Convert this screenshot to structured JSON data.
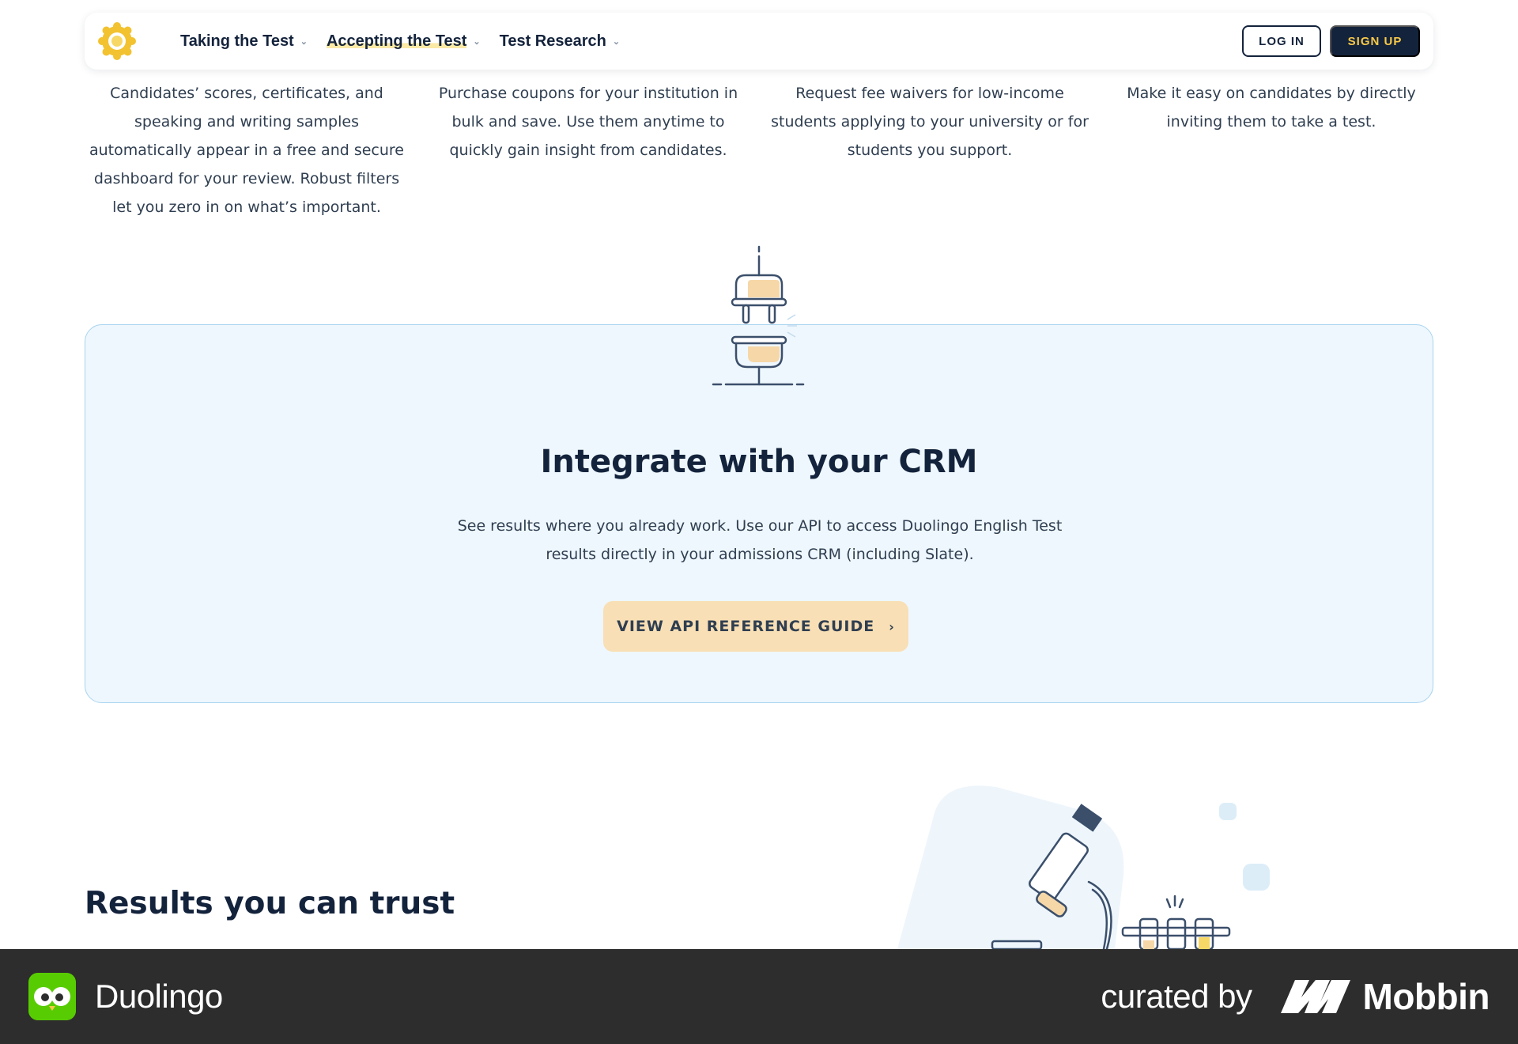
{
  "nav": {
    "items": [
      {
        "label": "Taking the Test"
      },
      {
        "label": "Accepting the Test"
      },
      {
        "label": "Test Research"
      }
    ],
    "login_label": "LOG IN",
    "signup_label": "SIGN UP"
  },
  "features": [
    {
      "text": "Candidates’ scores, certificates, and speaking and writing samples automatically appear in a free and secure dashboard for your review. Robust filters let you zero in on what’s important."
    },
    {
      "text": "Purchase coupons for your institution in bulk and save. Use them anytime to quickly gain insight from candidates."
    },
    {
      "text": "Request fee waivers for low-income students applying to your university or for students you support."
    },
    {
      "text": "Make it easy on candidates by directly inviting them to take a test."
    }
  ],
  "crm": {
    "title": "Integrate with your CRM",
    "body": "See results where you already work. Use our API to access Duolingo English Test results directly in your admissions CRM (including Slate).",
    "button_label": "VIEW API REFERENCE GUIDE",
    "button_icon": "chevron-right-icon"
  },
  "results": {
    "title": "Results you can trust"
  },
  "footer": {
    "app_name": "Duolingo",
    "curated_by": "curated by",
    "brand": "Mobbin"
  },
  "colors": {
    "navy": "#14233c",
    "accent_yellow": "#f7c948",
    "card_bg": "#eef7fd",
    "card_border": "#a7d4ef",
    "button_peach": "#f8dfb5",
    "footer_bg": "#2d2d2d",
    "duolingo_green": "#58cc02"
  }
}
